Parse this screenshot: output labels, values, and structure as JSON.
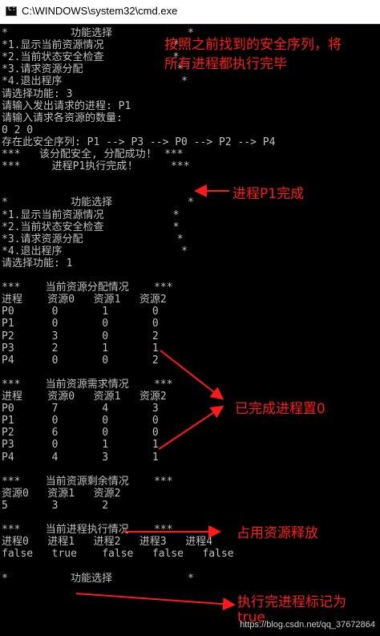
{
  "window": {
    "title": "C:\\WINDOWS\\system32\\cmd.exe",
    "icon": "cmd-icon"
  },
  "console": {
    "lines": [
      "*          功能选择            *",
      "*1.显示当前资源情况           *",
      "*2.当前状态安全检查           *",
      "*3.请求资源分配               *",
      "*4.退出程序                   *",
      "请选择功能: 3",
      "请输入发出请求的进程: P1",
      "请输入请求各资源的数量:",
      "0 2 0",
      "存在此安全序列: P1 --> P3 --> P0 --> P2 --> P4",
      "***   该分配安全, 分配成功!  ***",
      "***     进程P1执行完成!      ***",
      "",
      "",
      "*          功能选择            *",
      "*1.显示当前资源情况           *",
      "*2.当前状态安全检查           *",
      "*3.请求资源分配               *",
      "*4.退出程序                   *",
      "请选择功能: 1",
      "",
      "***    当前资源分配情况    ***",
      "进程    资源0   资源1   资源2",
      "P0      0       1       0",
      "P1      0       0       0",
      "P2      3       0       2",
      "P3      2       1       1",
      "P4      0       0       2",
      "",
      "***    当前资源需求情况    ***",
      "进程    资源0   资源1   资源2",
      "P0      7       4       3",
      "P1      0       0       0",
      "P2      6       0       0",
      "P3      0       1       1",
      "P4      4       3       1",
      "",
      "***    当前资源剩余情况    ***",
      "资源0   资源1   资源2",
      "5       3       2",
      "",
      "***    当前进程执行情况    ***",
      "进程0   进程1   进程2   进程3   进程4",
      "false   true    false   false   false",
      "",
      "*          功能选择            *"
    ]
  },
  "annotations": {
    "note1_line1": "按照之前找到的安全序列，将",
    "note1_line2": "所有进程都执行完毕",
    "note2": "进程P1完成",
    "note3": "已完成进程置0",
    "note4": "占用资源释放",
    "note5": "执行完进程标记为",
    "note5_line2": "true"
  },
  "watermark": "https://blog.csdn.net/qq_37672864",
  "colors": {
    "console_text": "#c0c0c0",
    "console_bg": "#000000",
    "annotation": "#ff1a1a"
  }
}
